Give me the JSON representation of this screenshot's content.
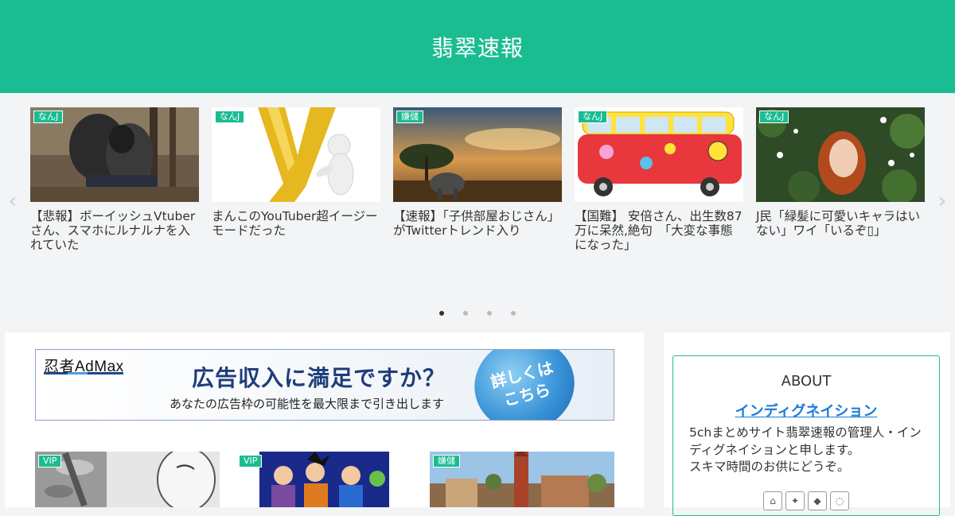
{
  "header": {
    "title": "翡翠速報"
  },
  "carousel": {
    "prev_arrow": "‹",
    "next_arrow": "›",
    "items": [
      {
        "category": "なんJ",
        "title": "【悲報】ボーイッシュVtuberさん、スマホにルナルナを入れていた"
      },
      {
        "category": "なんJ",
        "title": "まんこのYouTuber超イージーモードだった"
      },
      {
        "category": "嫌儲",
        "title": "【速報】「子供部屋おじさん」がTwitterトレンド入り"
      },
      {
        "category": "なんJ",
        "title": "【国難】 安倍さん、出生数87万に呆然,絶句　「大変な事態になった」"
      },
      {
        "category": "なんJ",
        "title": "J民「緑髪に可愛いキャラはいない」ワイ「いるぞ▯」"
      }
    ],
    "dots": 4,
    "active_dot": 0
  },
  "ad": {
    "logo": "忍者AdMax",
    "headline": "広告収入に満足ですか？",
    "sub": "あなたの広告枠の可能性を最大限まで引き出します",
    "button_line1": "詳しくは",
    "button_line2": "こちら"
  },
  "posts": [
    {
      "category": "VIP"
    },
    {
      "category": "VIP"
    },
    {
      "category": "嫌儲"
    }
  ],
  "sidebar": {
    "about_title": "ABOUT",
    "about_name": "インディグネイション",
    "about_text": "5chまとめサイト翡翠速報の管理人・インディグネイションと申します。\nスキマ時間のお供にどうぞ。",
    "social": [
      "home-icon",
      "twitter-icon",
      "feedly-icon",
      "rss-icon"
    ]
  },
  "colors": {
    "accent": "#1abc91",
    "link": "#1a7ad8"
  }
}
